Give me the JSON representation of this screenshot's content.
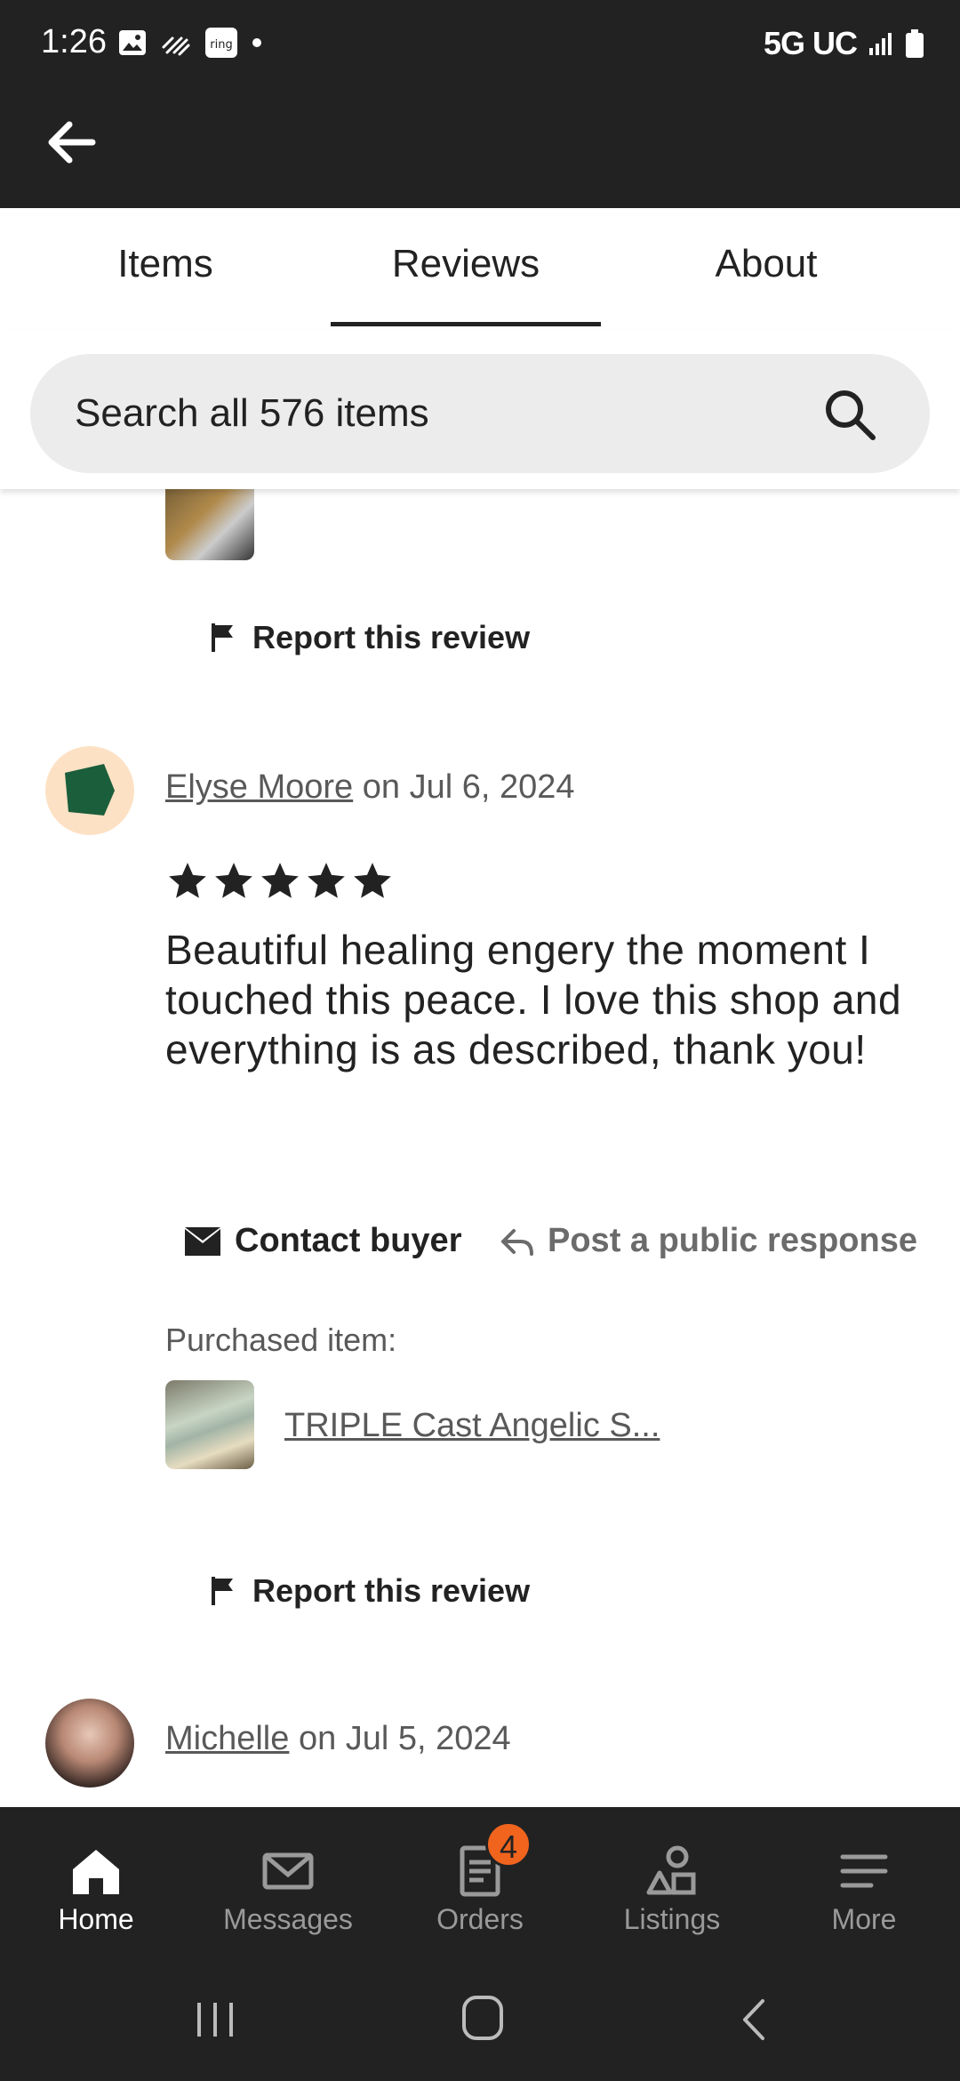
{
  "status_bar": {
    "time": "1:26",
    "network": "5G UC"
  },
  "tabs": [
    {
      "label": "Items"
    },
    {
      "label": "Reviews",
      "active": true
    },
    {
      "label": "About"
    }
  ],
  "search": {
    "placeholder": "Search all 576 items"
  },
  "reviews": [
    {
      "report_label": "Report this review"
    },
    {
      "reviewer": "Elyse Moore",
      "date_text": " on Jul 6, 2024",
      "rating": 5,
      "text": "Beautiful healing engery the moment I touched this peace. I love this shop and everything is as described, thank you!",
      "contact_label": "Contact buyer",
      "public_response_label": "Post a public response",
      "purchased_label": "Purchased item:",
      "purchased_title": "TRIPLE Cast Angelic S...",
      "report_label": "Report this review"
    },
    {
      "reviewer": "Michelle",
      "date_text": " on Jul 5, 2024"
    }
  ],
  "bottom_nav": {
    "items": [
      {
        "label": "Home",
        "icon": "home-icon",
        "active": true
      },
      {
        "label": "Messages",
        "icon": "envelope-icon"
      },
      {
        "label": "Orders",
        "icon": "receipt-icon",
        "badge": "4"
      },
      {
        "label": "Listings",
        "icon": "shapes-icon"
      },
      {
        "label": "More",
        "icon": "menu-icon"
      }
    ]
  },
  "colors": {
    "bar_background": "#222222",
    "badge": "#f1641e",
    "avatar_1_bg": "#fde1c4",
    "avatar_1_shape": "#1b5e3b"
  }
}
